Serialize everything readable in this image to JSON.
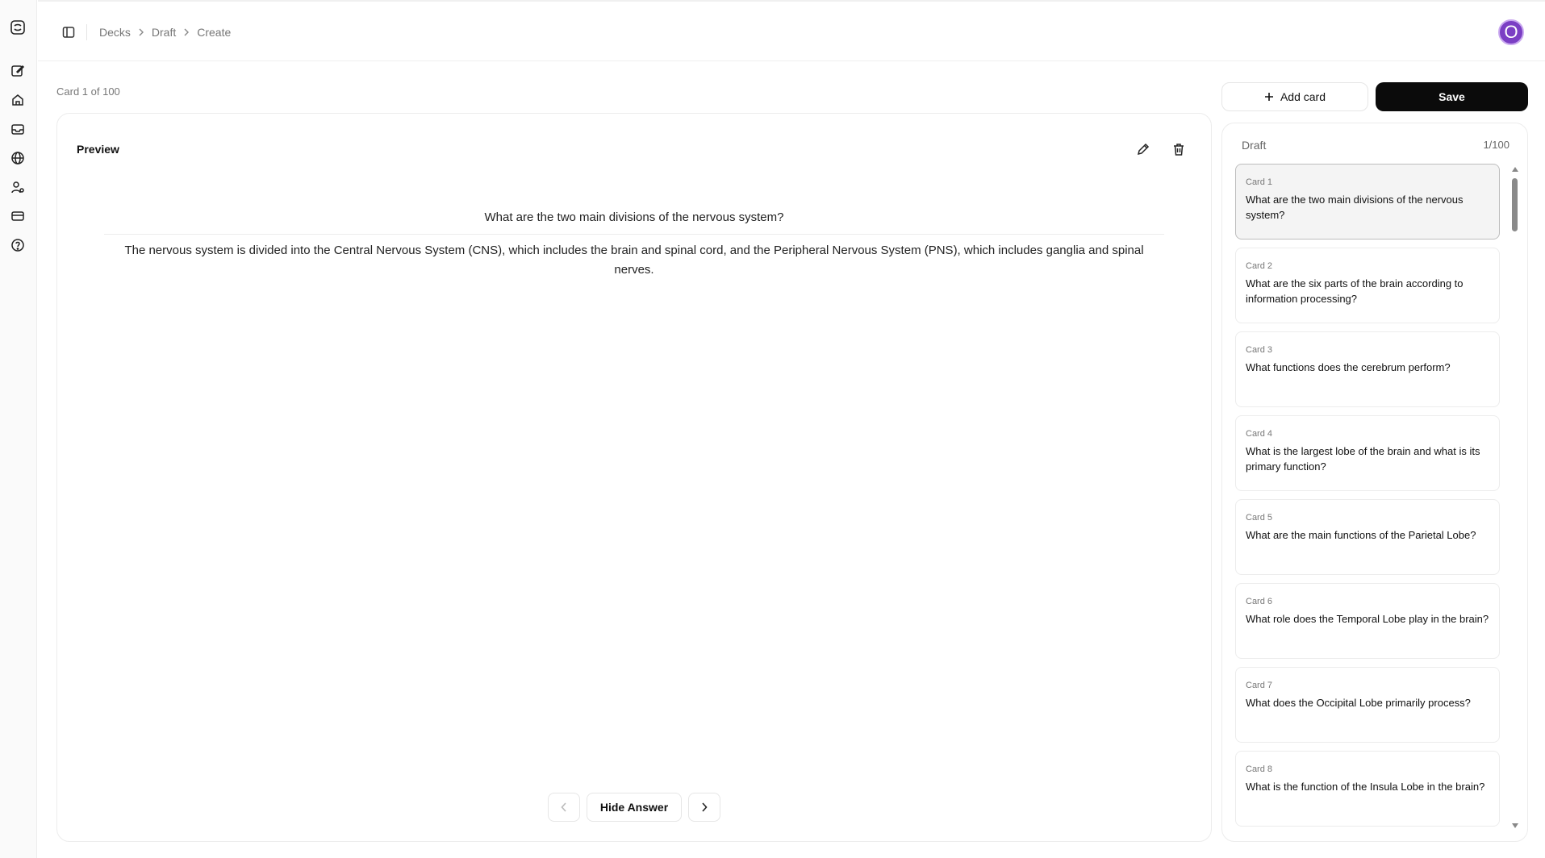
{
  "breadcrumb": [
    {
      "label": "Decks"
    },
    {
      "label": "Draft"
    },
    {
      "label": "Create"
    }
  ],
  "user": {
    "avatar_letter": "O"
  },
  "card_counter": "Card 1 of 100",
  "preview": {
    "title": "Preview",
    "question": "What are the two main divisions of the nervous system?",
    "answer": "The nervous system is divided into the Central Nervous System (CNS), which includes the brain and spinal cord, and the Peripheral Nervous System (PNS), which includes ganglia and spinal nerves.",
    "hide_answer_label": "Hide Answer"
  },
  "actions": {
    "add_card_label": "Add card",
    "save_label": "Save"
  },
  "draft": {
    "title": "Draft",
    "count": "1/100",
    "cards": [
      {
        "label": "Card 1",
        "question": "What are the two main divisions of the nervous system?"
      },
      {
        "label": "Card 2",
        "question": "What are the six parts of the brain according to information processing?"
      },
      {
        "label": "Card 3",
        "question": "What functions does the cerebrum perform?"
      },
      {
        "label": "Card 4",
        "question": "What is the largest lobe of the brain and what is its primary function?"
      },
      {
        "label": "Card 5",
        "question": "What are the main functions of the Parietal Lobe?"
      },
      {
        "label": "Card 6",
        "question": "What role does the Temporal Lobe play in the brain?"
      },
      {
        "label": "Card 7",
        "question": "What does the Occipital Lobe primarily process?"
      },
      {
        "label": "Card 8",
        "question": "What is the function of the Insula Lobe in the brain?"
      }
    ]
  },
  "colors": {
    "accent": "#7b3fc4",
    "primary_button": "#0b0b0b",
    "border": "#ececec"
  },
  "icons": {
    "rail": [
      "logo-icon",
      "edit-icon",
      "home-icon",
      "inbox-icon",
      "globe-icon",
      "user-settings-icon",
      "card-icon",
      "help-icon"
    ],
    "toolbar": [
      "pencil-icon",
      "trash-icon"
    ]
  }
}
